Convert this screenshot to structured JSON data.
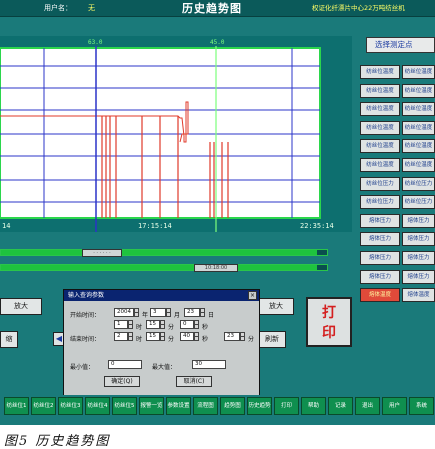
{
  "titlebar": {
    "user_label": "用户名：",
    "user_value": "无",
    "title": "历史趋势图",
    "company": "权证化纤漂片中心22万吨纺丝机"
  },
  "chart": {
    "cursor_labels": [
      "63.0",
      "45.0"
    ],
    "time_labels": [
      "14",
      "17:15:14",
      "22:35:14"
    ]
  },
  "scroll": {
    "upper_thumb": "· · · · · ·",
    "lower_thumb": "10:18:00"
  },
  "point_list": {
    "header": "选择测定点",
    "items": [
      [
        "纺丝位温度",
        "纺丝位温度"
      ],
      [
        "纺丝位温度",
        "纺丝位温度"
      ],
      [
        "纺丝位温度",
        "纺丝位温度"
      ],
      [
        "纺丝位温度",
        "纺丝位温度"
      ],
      [
        "纺丝位温度",
        "纺丝位温度"
      ],
      [
        "纺丝位温度",
        "纺丝位温度"
      ],
      [
        "纺丝位压力",
        "纺丝位压力"
      ],
      [
        "纺丝位压力",
        "纺丝位压力"
      ],
      [
        "熔体压力",
        "熔体压力"
      ],
      [
        "熔体压力",
        "熔体压力"
      ],
      [
        "熔体压力",
        "熔体压力"
      ],
      [
        "熔体压力",
        "熔体压力"
      ],
      [
        "熔体温度",
        "熔体温度"
      ]
    ]
  },
  "controls": {
    "btn_left_top": "放大",
    "btn_left_bottom": "缩",
    "btn_mid_top": "放大",
    "btn_mid_bottom": "刷新",
    "print_line1": "打",
    "print_line2": "印",
    "nav_left": "◀"
  },
  "dialog": {
    "title": "输入查询参数",
    "close": "×",
    "start_label": "开始时间：",
    "end_label": "结束时间：",
    "start_date": [
      "2004",
      "3",
      "23"
    ],
    "start_time": [
      "1",
      "15",
      "0"
    ],
    "end_date": [
      "2004",
      "3",
      "23"
    ],
    "end_time": [
      "2",
      "15",
      "40"
    ],
    "units_date": [
      "年",
      "月",
      "日"
    ],
    "units_time": [
      "时",
      "分",
      "秒"
    ],
    "extra_label": "分",
    "extra_value": "23",
    "min_label": "最小值：",
    "min_value": "0",
    "max_label": "最大值：",
    "max_value": "30",
    "ok": "确定(Q)",
    "cancel": "取消(C)"
  },
  "bottom_bar": [
    "纺丝位1",
    "纺丝位2",
    "纺丝位3",
    "纺丝位4",
    "纺丝位5",
    "报警一览",
    "参数设置",
    "流程图",
    "趋势图",
    "历史趋势",
    "打印",
    "帮助",
    "记录",
    "退出",
    "用户",
    "系统"
  ],
  "caption": "图5   历史趋势图",
  "colors": {
    "background": "#1a7a7a",
    "grid": "#2b34c8",
    "trend": "#e03a2a",
    "cursor": "#7cff7c"
  }
}
